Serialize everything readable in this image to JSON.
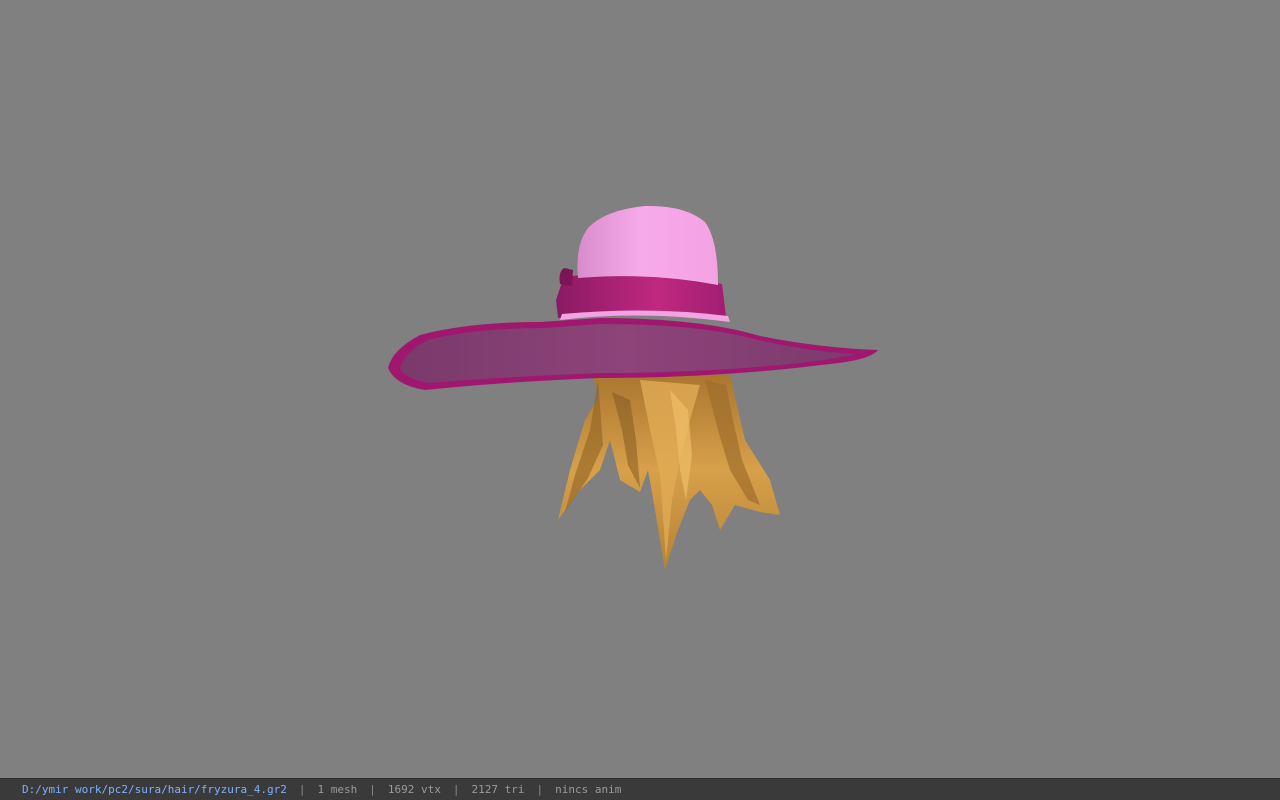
{
  "viewer": {
    "background_color": "#808080",
    "model_description_icon": "hat-with-hair-mesh-icon"
  },
  "status_bar": {
    "file_path": "D:/ymir work/pc2/sura/hair/fryzura_4.gr2",
    "separator": "|",
    "mesh_count": "1 mesh",
    "vertex_count": "1692 vtx",
    "triangle_count": "2127 tri",
    "anim_status": "nincs anim"
  },
  "colors": {
    "path_text": "#7fb0ff",
    "status_text": "#9a9a9a",
    "status_bg": "#3a3a3a",
    "hat_crown": "#f4a6e6",
    "hat_band": "#b3237f",
    "hat_brim": "#8a3f78",
    "hat_brim_edge": "#a0176f",
    "hair": "#c9953f"
  }
}
